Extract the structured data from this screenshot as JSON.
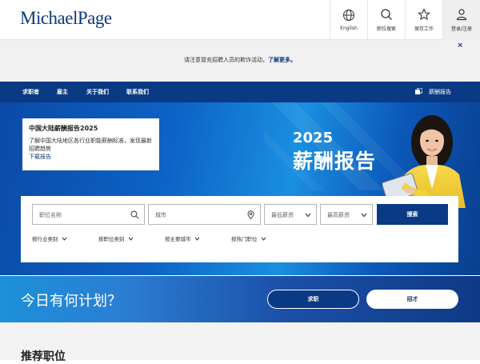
{
  "header": {
    "logo_left": "Michael",
    "logo_right": "Page",
    "nav": [
      {
        "label": "English",
        "icon": "globe-icon"
      },
      {
        "label": "职位搜索",
        "icon": "search-icon"
      },
      {
        "label": "保存工作",
        "icon": "star-icon"
      },
      {
        "label": "登录/注册",
        "icon": "user-icon"
      }
    ]
  },
  "notice": {
    "text": "请注意冒充招聘人员的欺诈活动，",
    "link": "了解更多。",
    "close": "×"
  },
  "main_nav": {
    "items": [
      "求职者",
      "雇主",
      "关于我们",
      "联系我们"
    ],
    "salary_link": "薪酬报告"
  },
  "hero": {
    "card": {
      "title": "中国大陆薪酬报告2025",
      "description": "了解中国大陆地区各行业职能薪酬标准，发现最新招聘趋势",
      "link": "下载报告"
    },
    "year": "2025",
    "title": "薪酬报告"
  },
  "search": {
    "keyword_placeholder": "职位名称",
    "city_placeholder": "城市",
    "min_salary": "最低薪资",
    "max_salary": "最高薪资",
    "button": "搜索",
    "filters": [
      "按行业类别",
      "按职位类别",
      "按主要城市",
      "按热门职位"
    ]
  },
  "plans": {
    "title": "今日有何计划？",
    "job_seeker_button": "求职",
    "hire_button": "招才"
  },
  "recommended": {
    "title": "推荐职位"
  },
  "colors": {
    "brand_navy": "#0b3a84",
    "notice_bg": "#f1f1f1"
  }
}
